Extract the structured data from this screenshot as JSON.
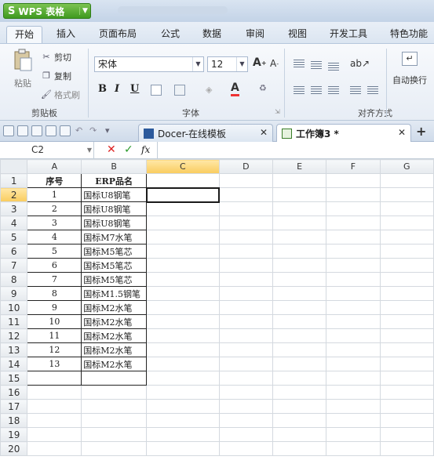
{
  "app": {
    "name": "WPS 表格",
    "logo": "S"
  },
  "menu": [
    "开始",
    "插入",
    "页面布局",
    "公式",
    "数据",
    "审阅",
    "视图",
    "开发工具",
    "特色功能"
  ],
  "ribbon": {
    "paste": "粘贴",
    "cut": "剪切",
    "copy": "复制",
    "format_painter": "格式刷",
    "clipboard_label": "剪贴板",
    "font_name": "宋体",
    "font_size": "12",
    "bold": "B",
    "italic": "I",
    "underline": "U",
    "font_label": "字体",
    "align_label": "对齐方式",
    "wrap": "自动换行"
  },
  "tabs": {
    "template": "Docer-在线模板",
    "workbook": "工作簿3 *"
  },
  "formula": {
    "cell_ref": "C2",
    "fx": "fx"
  },
  "columns": [
    "A",
    "B",
    "C",
    "D",
    "E",
    "F",
    "G"
  ],
  "rows": [
    [
      "序号",
      "ERP品名"
    ],
    [
      "1",
      "国标U8钢笔"
    ],
    [
      "2",
      "国标U8钢笔"
    ],
    [
      "3",
      "国标U8钢笔"
    ],
    [
      "4",
      "国标M7水笔"
    ],
    [
      "5",
      "国标M5笔芯"
    ],
    [
      "6",
      "国标M5笔芯"
    ],
    [
      "7",
      "国标M5笔芯"
    ],
    [
      "8",
      "国标M1.5钢笔"
    ],
    [
      "9",
      "国标M2水笔"
    ],
    [
      "10",
      "国标M2水笔"
    ],
    [
      "11",
      "国标M2水笔"
    ],
    [
      "12",
      "国标M2水笔"
    ],
    [
      "13",
      "国标M2水笔"
    ],
    [
      "",
      ""
    ],
    [
      "",
      ""
    ],
    [
      "",
      ""
    ],
    [
      "",
      ""
    ],
    [
      "",
      ""
    ],
    [
      "",
      ""
    ]
  ],
  "row_numbers": [
    "1",
    "2",
    "3",
    "4",
    "5",
    "6",
    "7",
    "8",
    "9",
    "10",
    "11",
    "12",
    "13",
    "14",
    "15",
    "16",
    "17",
    "18",
    "19",
    "20"
  ],
  "active_cell": {
    "col": "C",
    "row": "2"
  },
  "colors": {
    "accent_green": "#3f9a20",
    "active_header": "#f9cc5e"
  }
}
